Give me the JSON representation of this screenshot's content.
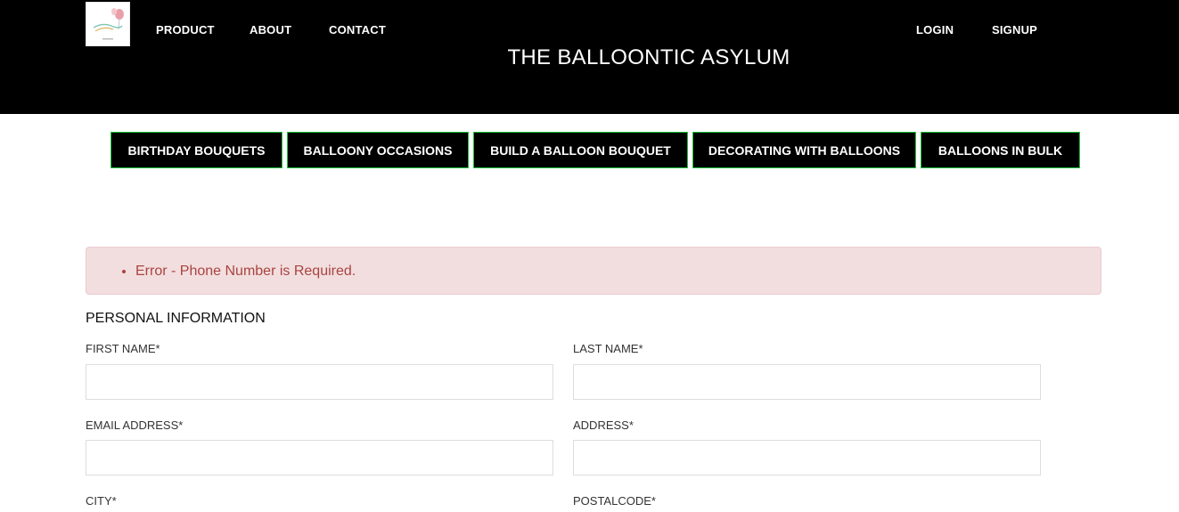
{
  "header": {
    "logo_icon": "balloon-logo-icon",
    "nav_left": [
      "PRODUCT",
      "ABOUT",
      "CONTACT"
    ],
    "nav_right": [
      "LOGIN",
      "SIGNUP"
    ],
    "site_title": "THE BALLOONTIC ASYLUM",
    "background_color": "#000000"
  },
  "categories": [
    "BIRTHDAY BOUQUETS",
    "BALLOONY OCCASIONS",
    "BUILD A BALLOON BOUQUET",
    "DECORATING WITH BALLOONS",
    "BALLOONS IN BULK"
  ],
  "category_border_color": "#1cc43a",
  "alert": {
    "message": "Error - Phone Number is Required.",
    "background_color": "#f2dede",
    "text_color": "#a94442"
  },
  "form": {
    "section_title": "PERSONAL INFORMATION",
    "first_name_label": "FIRST NAME*",
    "first_name_value": "",
    "last_name_label": "LAST NAME*",
    "last_name_value": "",
    "email_label": "EMAIL ADDRESS*",
    "email_value": "",
    "address_label": "ADDRESS*",
    "address_value": "",
    "city_label": "CITY*",
    "postalcode_label": "POSTALCODE*"
  }
}
